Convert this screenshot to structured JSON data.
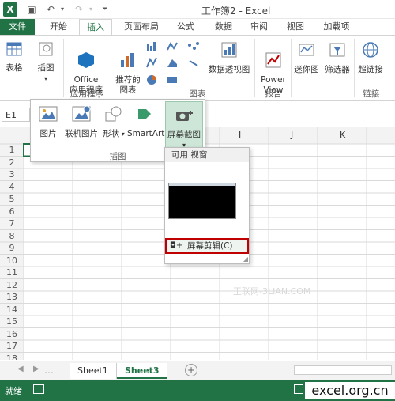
{
  "titlebar": {
    "title": "工作簿2 - Excel",
    "logo_letter": "X"
  },
  "tabs": [
    "文件",
    "开始",
    "插入",
    "页面布局",
    "公式",
    "数据",
    "审阅",
    "视图",
    "加载项"
  ],
  "ribbon": {
    "table": "表格",
    "illustrations": "插图",
    "office_apps": "Office\n应用程序",
    "recommended_charts": "推荐的\n图表",
    "pivot_chart": "数据透视图",
    "power_view": "Power\nView",
    "sparklines": "迷你图",
    "filter": "筛选器",
    "hyperlink": "超链接",
    "group_apps": "应用程序",
    "group_charts": "图表",
    "group_reports": "报告",
    "group_links": "链接"
  },
  "namebox": "E1",
  "columns": [
    "I",
    "J",
    "K"
  ],
  "rows": [
    "1",
    "2",
    "3",
    "4",
    "5",
    "6",
    "7",
    "8",
    "9",
    "10",
    "11",
    "12",
    "13",
    "14",
    "15",
    "16",
    "17",
    "18"
  ],
  "insert_panel": {
    "picture": "图片",
    "online_picture": "联机图片",
    "shapes": "形状",
    "smartart": "SmartArt",
    "screenshot": "屏幕截图",
    "group_label": "插图"
  },
  "screenshot_panel": {
    "available_windows": "可用 视窗",
    "screen_clipping": "屏幕剪辑(C)"
  },
  "watermark": "王联网-3LIAN.COM",
  "sheets": [
    "Sheet1",
    "Sheet3"
  ],
  "status": "就绪",
  "site_watermark": "excel.org.cn",
  "colors": {
    "excel_green": "#217346",
    "highlight_red": "#c00000"
  }
}
